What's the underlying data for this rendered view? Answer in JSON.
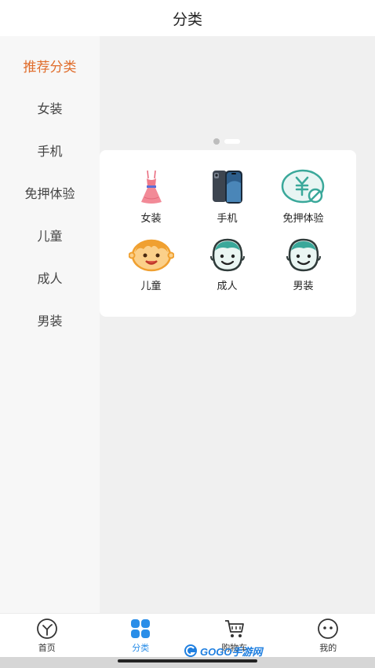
{
  "header": {
    "title": "分类"
  },
  "sidebar": {
    "items": [
      {
        "label": "推荐分类",
        "active": true
      },
      {
        "label": "女装"
      },
      {
        "label": "手机"
      },
      {
        "label": "免押体验"
      },
      {
        "label": "儿童"
      },
      {
        "label": "成人"
      },
      {
        "label": "男装"
      }
    ]
  },
  "carousel": {
    "active_index": 0,
    "count": 2
  },
  "grid": {
    "items": [
      {
        "label": "女装",
        "icon": "dress-icon"
      },
      {
        "label": "手机",
        "icon": "phone-icon"
      },
      {
        "label": "免押体验",
        "icon": "deposit-free-icon"
      },
      {
        "label": "儿童",
        "icon": "child-face-icon"
      },
      {
        "label": "成人",
        "icon": "adult-face-icon"
      },
      {
        "label": "男装",
        "icon": "man-face-icon"
      }
    ]
  },
  "tabbar": {
    "items": [
      {
        "label": "首页",
        "icon": "home-icon"
      },
      {
        "label": "分类",
        "icon": "category-icon",
        "active": true
      },
      {
        "label": "购物车",
        "icon": "cart-icon"
      },
      {
        "label": "我的",
        "icon": "profile-icon"
      }
    ]
  },
  "watermark": {
    "text": "GOGO手游网"
  },
  "colors": {
    "accent": "#e06d2c",
    "tab_active": "#2a8ee8",
    "teal": "#3aa89a",
    "child_orange": "#f0a030"
  }
}
